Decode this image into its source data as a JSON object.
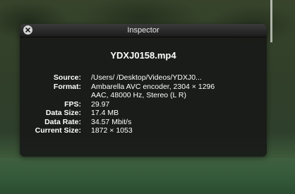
{
  "window": {
    "title": "Inspector",
    "filename": "YDXJ0158.mp4"
  },
  "properties": [
    {
      "label": "Source:",
      "value": "/Users/        /Desktop/Videos/YDXJ0..."
    },
    {
      "label": "Format:",
      "value": "Ambarella AVC encoder, 2304 × 1296"
    },
    {
      "label": "",
      "value": "AAC, 48000 Hz, Stereo (L R)"
    },
    {
      "label": "FPS:",
      "value": "29.97"
    },
    {
      "label": "Data Size:",
      "value": "17.4 MB"
    },
    {
      "label": "Data Rate:",
      "value": "34.57 Mbit/s"
    },
    {
      "label": "Current Size:",
      "value": "1872 × 1053"
    }
  ],
  "icons": {
    "close": "close-icon"
  },
  "colors": {
    "panel": "#161616",
    "text": "#ffffff",
    "close_button": "#d6d6d6"
  }
}
